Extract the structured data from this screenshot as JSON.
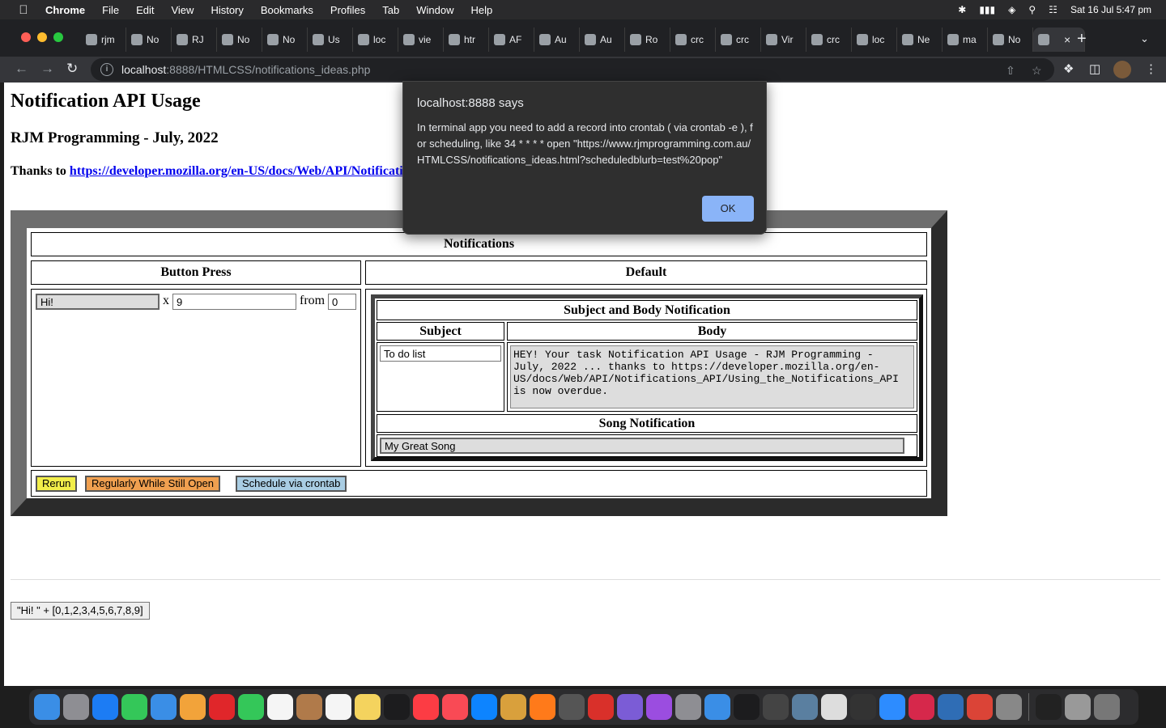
{
  "menubar": {
    "app": "Chrome",
    "items": [
      "File",
      "Edit",
      "View",
      "History",
      "Bookmarks",
      "Profiles",
      "Tab",
      "Window",
      "Help"
    ],
    "datetime": "Sat 16 Jul  5:47 pm"
  },
  "tabs": [
    "rjm",
    "No",
    "RJ",
    "No",
    "No",
    "Us",
    "loc",
    "vie",
    "htr",
    "AF",
    "Au",
    "Au",
    "Ro",
    "crc",
    "crc",
    "Vir",
    "crc",
    "loc",
    "Ne",
    "ma",
    "No",
    ""
  ],
  "address": {
    "host": "localhost",
    "path": ":8888/HTMLCSS/notifications_ideas.php"
  },
  "page": {
    "title": "Notification API Usage",
    "subtitle": "RJM Programming - July, 2022",
    "thanks_label": "Thanks to",
    "thanks_link": "https://developer.mozilla.org/en-US/docs/Web/API/Notificati",
    "table": {
      "caption": "Notifications",
      "col_left": "Button Press",
      "col_right": "Default",
      "button_press": {
        "text_value": "Hi!",
        "x_label": "x",
        "count_value": "9",
        "from_label": "from",
        "from_value": "0"
      },
      "subject_body": {
        "caption": "Subject and Body Notification",
        "subject_header": "Subject",
        "body_header": "Body",
        "subject_value": "To do list",
        "body_value": "HEY! Your task Notification API Usage - RJM Programming - July, 2022 ... thanks to https://developer.mozilla.org/en-US/docs/Web/API/Notifications_API/Using_the_Notifications_API is now overdue."
      },
      "song": {
        "caption": "Song Notification",
        "value": "My Great Song"
      },
      "buttons": {
        "rerun": "Rerun",
        "regularly": "Regularly While Still Open",
        "schedule": "Schedule via crontab"
      }
    },
    "result_button": "\"Hi! \" + [0,1,2,3,4,5,6,7,8,9]"
  },
  "alert": {
    "title": "localhost:8888 says",
    "message": "In terminal app you need to add a record into crontab ( via crontab -e ), for scheduling, like 34 * * * * open \"https://www.rjmprogramming.com.au/HTMLCSS/notifications_ideas.html?scheduledblurb=test%20pop\"",
    "ok": "OK"
  },
  "colors": {
    "rerun_bg": "#f2ee4a",
    "regularly_bg": "#f0a050",
    "schedule_bg": "#a9cde3",
    "alert_ok": "#8ab4f8"
  },
  "icons": [
    "apple-icon",
    "bluetooth-icon",
    "battery-icon",
    "wifi-icon",
    "search-icon",
    "control-center-icon",
    "back-icon",
    "forward-icon",
    "reload-icon",
    "info-icon",
    "share-icon",
    "star-icon",
    "extensions-icon",
    "sidepanel-icon",
    "menu-icon"
  ]
}
